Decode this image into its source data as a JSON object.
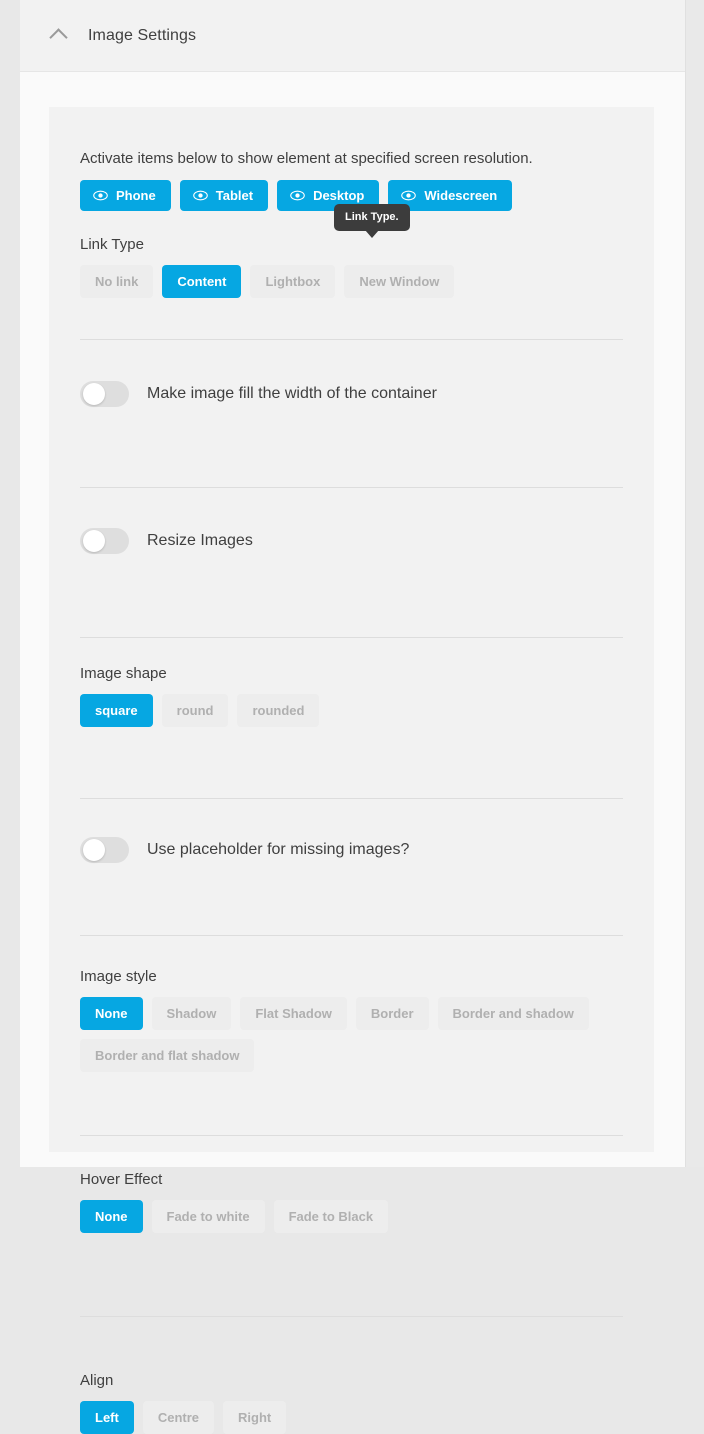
{
  "panel": {
    "title": "Image Settings",
    "collapse_icon": "chevron-up-icon"
  },
  "intro": {
    "text": "Activate items below to show element at specified screen resolution."
  },
  "resolutions": {
    "icon": "eye-icon",
    "items": [
      {
        "label": "Phone",
        "active": true
      },
      {
        "label": "Tablet",
        "active": true
      },
      {
        "label": "Desktop",
        "active": true
      },
      {
        "label": "Widescreen",
        "active": true
      }
    ]
  },
  "tooltip": {
    "text": "Link Type."
  },
  "link_type": {
    "label": "Link Type",
    "options": [
      "No link",
      "Content",
      "Lightbox",
      "New Window"
    ],
    "selected": "Content"
  },
  "fill_width": {
    "label": "Make image fill the width of the container",
    "enabled": false
  },
  "resize_images": {
    "label": "Resize Images",
    "enabled": false
  },
  "image_shape": {
    "label": "Image shape",
    "options": [
      "square",
      "round",
      "rounded"
    ],
    "selected": "square"
  },
  "placeholder": {
    "label": "Use placeholder for missing images?",
    "enabled": false
  },
  "image_style": {
    "label": "Image style",
    "options": [
      "None",
      "Shadow",
      "Flat Shadow",
      "Border",
      "Border and shadow",
      "Border and flat shadow"
    ],
    "selected": "None"
  },
  "hover_effect": {
    "label": "Hover Effect",
    "options": [
      "None",
      "Fade to white",
      "Fade to Black"
    ],
    "selected": "None"
  },
  "align": {
    "label": "Align",
    "options": [
      "Left",
      "Centre",
      "Right"
    ],
    "selected": "Left"
  },
  "colors": {
    "accent": "#06a7e2",
    "panel_bg": "#f2f2f2",
    "window_bg": "#fafafa",
    "text": "#3f3f3f",
    "muted_text": "#b0b0b0",
    "tooltip_bg": "#3c3c3c"
  }
}
